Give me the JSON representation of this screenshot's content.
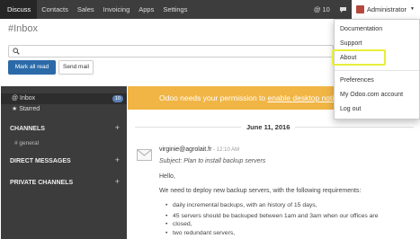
{
  "topbar": {
    "nav": [
      "Discuss",
      "Contacts",
      "Sales",
      "Invoicing",
      "Apps",
      "Settings"
    ],
    "active_nav": "Discuss",
    "messages_count": "10",
    "user_name": "Administrator"
  },
  "control": {
    "title": "#Inbox",
    "search_placeholder": "",
    "mark_all_read": "Mark all read",
    "send_mail": "Send mail"
  },
  "sidebar": {
    "inbox_label": "@ Inbox",
    "inbox_count": "10",
    "starred_label": "★ Starred",
    "channels_heading": "CHANNELS",
    "general_channel": "# general",
    "direct_messages_heading": "DIRECT MESSAGES",
    "private_channels_heading": "PRIVATE CHANNELS",
    "add_symbol": "+"
  },
  "banner": {
    "text": "Odoo needs your permission to ",
    "link": "enable desktop notifications."
  },
  "thread": {
    "date": "June 11, 2016",
    "author": "virginie@agrolait.fr",
    "time": " - 12:10 AM",
    "subject": "Subject: Plan to install backup servers",
    "greeting": "Hello,",
    "intro": "We need to deploy new backup servers, with the following requirements:",
    "bullets": [
      "daily incremental backups, with an history of 15 days,",
      "45 servers should be backuped between 1am and 3am when our offices are",
      "closed,",
      "two redundant servers,"
    ]
  },
  "user_menu": {
    "items": [
      "Documentation",
      "Support",
      "About",
      "Preferences",
      "My Odoo.com account",
      "Log out"
    ]
  },
  "colors": {
    "topbar": "#3d3d3d",
    "primary_button": "#2b6aa8",
    "banner": "#f1b545",
    "sidebar": "#3c3c3c",
    "highlight": "#e8ee3a"
  }
}
